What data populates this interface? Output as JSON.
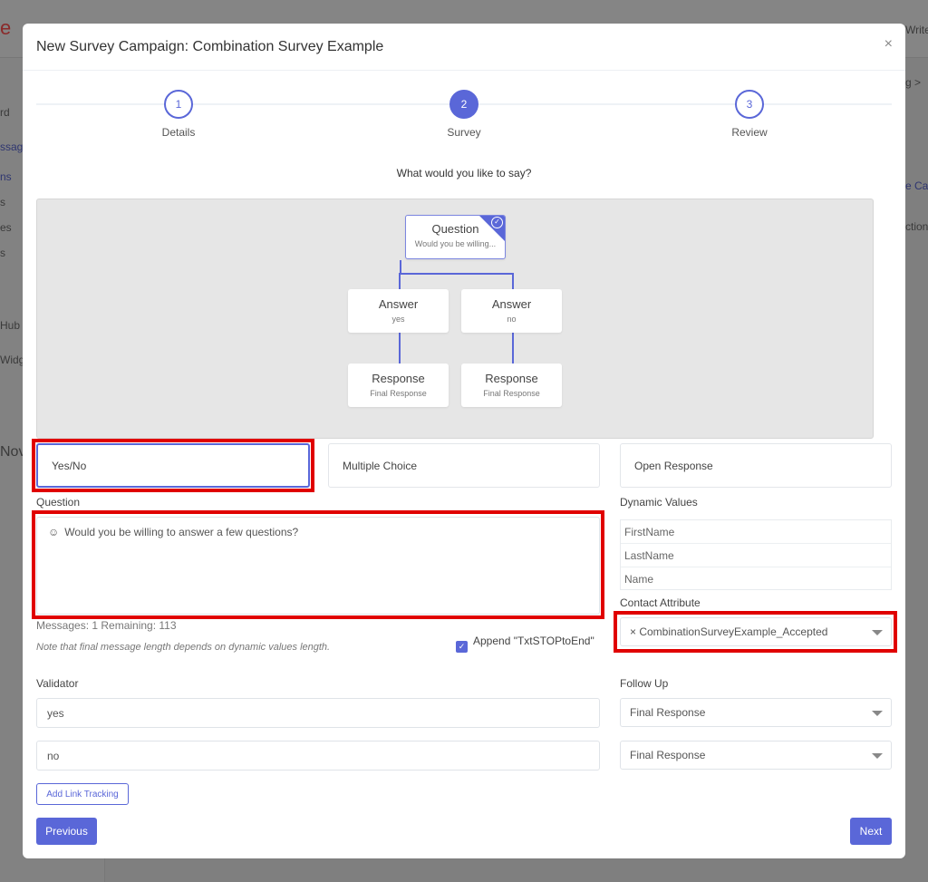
{
  "background": {
    "logo_fragment": "e",
    "top_right_fragment": "Write",
    "breadcrumb_fragment": "g  >",
    "sidebar_fragments": [
      "rd",
      "ssag",
      "ns",
      "s",
      "es",
      "s",
      "Hub",
      "Widg"
    ],
    "heading_fragment": "Nov",
    "right_fragments": [
      "e Ca",
      "ction"
    ]
  },
  "modal": {
    "title": "New Survey Campaign: Combination Survey Example",
    "close_label": "×",
    "steps": [
      {
        "number": "1",
        "label": "Details",
        "state": "complete"
      },
      {
        "number": "2",
        "label": "Survey",
        "state": "active"
      },
      {
        "number": "3",
        "label": "Review",
        "state": "pending"
      }
    ],
    "prompt": "What would you like to say?",
    "flow": {
      "question": {
        "title": "Question",
        "subtitle": "Would you be willing..."
      },
      "answers": [
        {
          "title": "Answer",
          "subtitle": "yes"
        },
        {
          "title": "Answer",
          "subtitle": "no"
        }
      ],
      "responses": [
        {
          "title": "Response",
          "subtitle": "Final Response"
        },
        {
          "title": "Response",
          "subtitle": "Final Response"
        }
      ]
    },
    "question_types": [
      {
        "label": "Yes/No",
        "selected": true
      },
      {
        "label": "Multiple Choice",
        "selected": false
      },
      {
        "label": "Open Response",
        "selected": false
      }
    ],
    "question_label": "Question",
    "question_text": "Would you be willing to answer a few questions?",
    "emoji_icon": "☺",
    "dynamic_values_label": "Dynamic Values",
    "dynamic_values": [
      "FirstName",
      "LastName",
      "Name"
    ],
    "contact_attribute_label": "Contact Attribute",
    "contact_attribute_value": "× CombinationSurveyExample_Accepted",
    "messages_info": "Messages: 1 Remaining: 113",
    "note": "Note that final message length depends on dynamic values length.",
    "append_label": "Append \"TxtSTOPtoEnd\"",
    "append_checked": true,
    "validator_label": "Validator",
    "follow_up_label": "Follow Up",
    "validators": [
      {
        "value": "yes",
        "follow_up": "Final Response"
      },
      {
        "value": "no",
        "follow_up": "Final Response"
      }
    ],
    "add_link_tracking": "Add Link Tracking",
    "previous": "Previous",
    "next": "Next"
  },
  "colors": {
    "accent": "#5a67d8",
    "highlight": "#e00000"
  }
}
